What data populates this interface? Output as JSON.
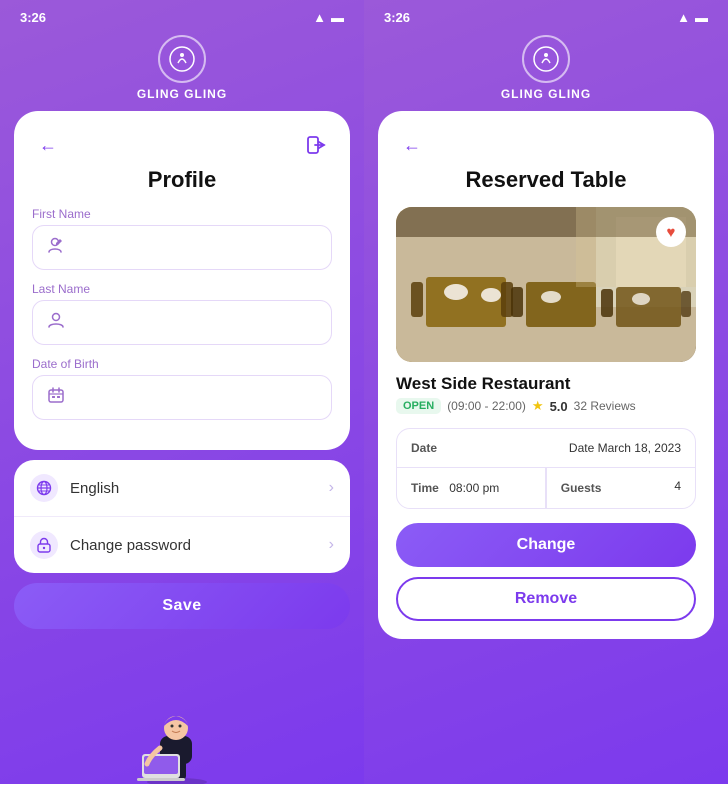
{
  "left": {
    "statusBar": {
      "time": "3:26"
    },
    "appName": "GLING GLING",
    "backIcon": "←",
    "logoutIcon": "⎋",
    "pageTitle": "Profile",
    "form": {
      "firstName": {
        "label": "First Name",
        "placeholder": ""
      },
      "lastName": {
        "label": "Last Name",
        "placeholder": ""
      },
      "dob": {
        "label": "Date of Birth",
        "placeholder": ""
      }
    },
    "settings": [
      {
        "label": "English",
        "icon": "🌐"
      },
      {
        "label": "Change password",
        "icon": "🔒"
      }
    ],
    "saveButton": "Save"
  },
  "right": {
    "statusBar": {
      "time": "3:26"
    },
    "appName": "GLING GLING",
    "backIcon": "←",
    "pageTitle": "Reserved Table",
    "restaurant": {
      "name": "West Side Restaurant",
      "status": "OPEN",
      "hours": "(09:00 - 22:00)",
      "rating": "5.0",
      "reviews": "32 Reviews"
    },
    "booking": {
      "dateLabel": "Date",
      "dateValue": "Date March 18, 2023",
      "timeLabel": "Time",
      "timeValue": "08:00 pm",
      "guestsLabel": "Guests",
      "guestsValue": "4"
    },
    "changeButton": "Change",
    "removeButton": "Remove"
  }
}
